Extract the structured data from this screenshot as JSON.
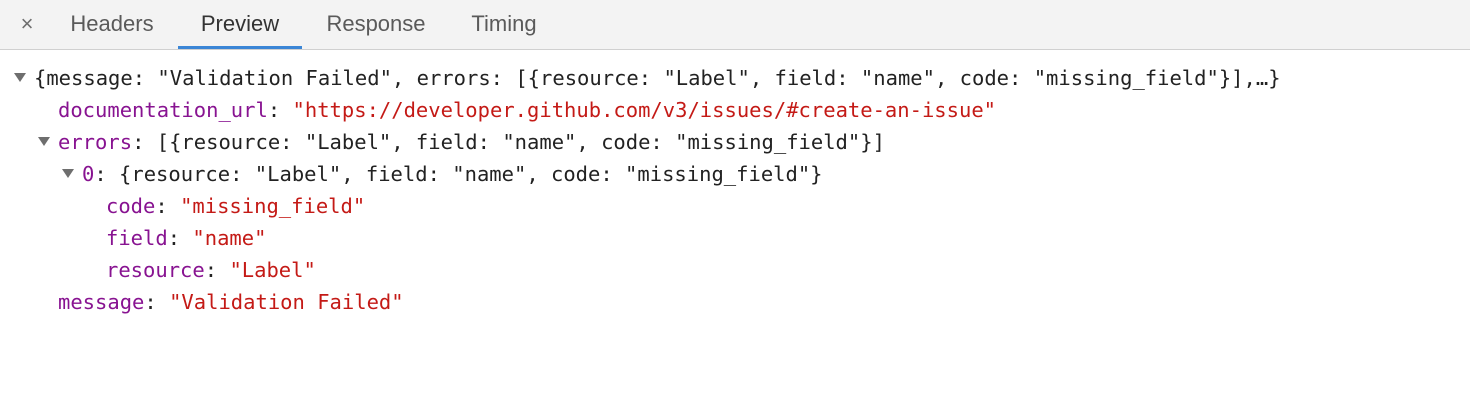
{
  "tabs": {
    "close_icon": "×",
    "items": [
      {
        "label": "Headers",
        "active": false
      },
      {
        "label": "Preview",
        "active": true
      },
      {
        "label": "Response",
        "active": false
      },
      {
        "label": "Timing",
        "active": false
      }
    ]
  },
  "preview": {
    "summary": "{message: \"Validation Failed\", errors: [{resource: \"Label\", field: \"name\", code: \"missing_field\"}],…}",
    "documentation_url": {
      "key": "documentation_url",
      "value": "\"https://developer.github.com/v3/issues/#create-an-issue\""
    },
    "errors": {
      "key": "errors",
      "summary": "[{resource: \"Label\", field: \"name\", code: \"missing_field\"}]",
      "item0": {
        "key": "0",
        "summary": "{resource: \"Label\", field: \"name\", code: \"missing_field\"}",
        "code": {
          "key": "code",
          "value": "\"missing_field\""
        },
        "field": {
          "key": "field",
          "value": "\"name\""
        },
        "resource": {
          "key": "resource",
          "value": "\"Label\""
        }
      }
    },
    "message": {
      "key": "message",
      "value": "\"Validation Failed\""
    }
  },
  "colors": {
    "key": "#881391",
    "string": "#c41a16",
    "active_tab_underline": "#3b86d6"
  }
}
